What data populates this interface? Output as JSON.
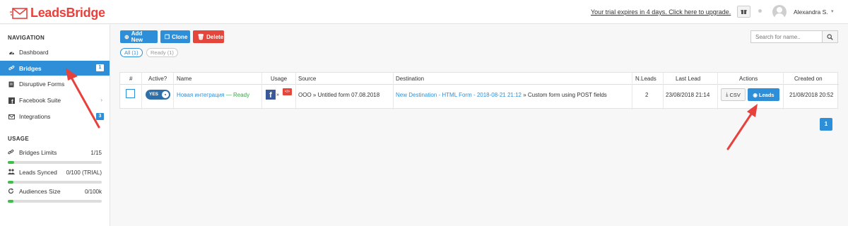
{
  "header": {
    "logo_text": "LeadsBridge",
    "trial_text": "Your trial expires in 4 days. Click here to upgrade.",
    "user_name": "Alexandra S."
  },
  "sidebar": {
    "nav_heading": "NAVIGATION",
    "items": [
      {
        "label": "Dashboard",
        "icon": "dashboard-icon"
      },
      {
        "label": "Bridges",
        "icon": "link-icon",
        "badge": "1"
      },
      {
        "label": "Disruptive Forms",
        "icon": "file-icon"
      },
      {
        "label": "Facebook Suite",
        "icon": "facebook-icon"
      },
      {
        "label": "Integrations",
        "icon": "envelope-icon",
        "badge": "3"
      }
    ],
    "usage_heading": "USAGE",
    "usage": [
      {
        "label": "Bridges Limits",
        "value": "1/15",
        "fraction": 0.067
      },
      {
        "label": "Leads Synced",
        "value": "0/100 (TRIAL)",
        "fraction": 0.03
      },
      {
        "label": "Audiences Size",
        "value": "0/100k",
        "fraction": 0.03
      }
    ]
  },
  "toolbar": {
    "add_label": "Add New",
    "clone_label": "Clone",
    "delete_label": "Delete",
    "filter_all": "All (1)",
    "filter_ready": "Ready (1)",
    "search_placeholder": "Search for name.."
  },
  "table": {
    "headers": {
      "num": "#",
      "active": "Active?",
      "name": "Name",
      "usage": "Usage",
      "source": "Source",
      "destination": "Destination",
      "nleads": "N.Leads",
      "last_lead": "Last Lead",
      "actions": "Actions",
      "created": "Created on"
    },
    "rows": [
      {
        "toggle": "YES",
        "name": "Новая интеграция",
        "status": "— Ready",
        "usage_sep": "»",
        "source": "OOO » Untitled form 07.08.2018",
        "destination_link": "New Destination - HTML Form - 2018-08-21 21:12",
        "destination_rest": "» Custom form using POST fields",
        "nleads": "2",
        "last_lead": "23/08/2018 21:14",
        "csv_label": "CSV",
        "leads_label": "Leads",
        "created": "21/08/2018 20:52"
      }
    ]
  },
  "pagination": {
    "current": "1"
  },
  "colors": {
    "accent": "#2e8fd8",
    "danger": "#e4463b",
    "success": "#3cc04b",
    "annotation": "#e8413c"
  }
}
